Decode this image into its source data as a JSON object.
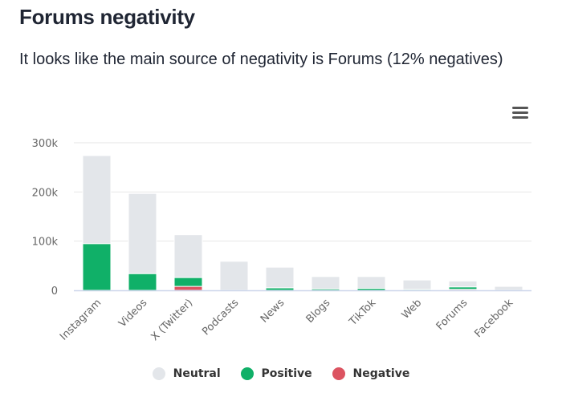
{
  "header": {
    "title": "Forums negativity",
    "subtitle": "It looks like the main source of negativity is Forums (12% negatives)"
  },
  "menu": {
    "icon": "hamburger-menu-icon"
  },
  "chart_data": {
    "type": "bar",
    "stacked": true,
    "title": "",
    "xlabel": "",
    "ylabel": "",
    "ylim": [
      0,
      300000
    ],
    "yticks": [
      0,
      100000,
      200000,
      300000
    ],
    "ytick_labels": [
      "0",
      "100k",
      "200k",
      "300k"
    ],
    "grid": true,
    "legend_position": "bottom",
    "categories": [
      "Instagram",
      "Videos",
      "X (Twitter)",
      "Podcasts",
      "News",
      "Blogs",
      "TikTok",
      "Web",
      "Forums",
      "Facebook"
    ],
    "series": [
      {
        "name": "Neutral",
        "color": "#e3e6ea",
        "values": [
          179000,
          163000,
          87000,
          59000,
          42000,
          25000,
          24000,
          19000,
          12000,
          8000
        ]
      },
      {
        "name": "Positive",
        "color": "#10b068",
        "values": [
          95000,
          34000,
          18000,
          0,
          5000,
          3000,
          4000,
          2000,
          5000,
          0
        ]
      },
      {
        "name": "Negative",
        "color": "#dc5461",
        "values": [
          0,
          0,
          8000,
          0,
          0,
          0,
          0,
          0,
          2000,
          0
        ]
      }
    ]
  },
  "legend": [
    {
      "label": "Neutral",
      "color": "#e3e6ea"
    },
    {
      "label": "Positive",
      "color": "#10b068"
    },
    {
      "label": "Negative",
      "color": "#dc5461"
    }
  ]
}
